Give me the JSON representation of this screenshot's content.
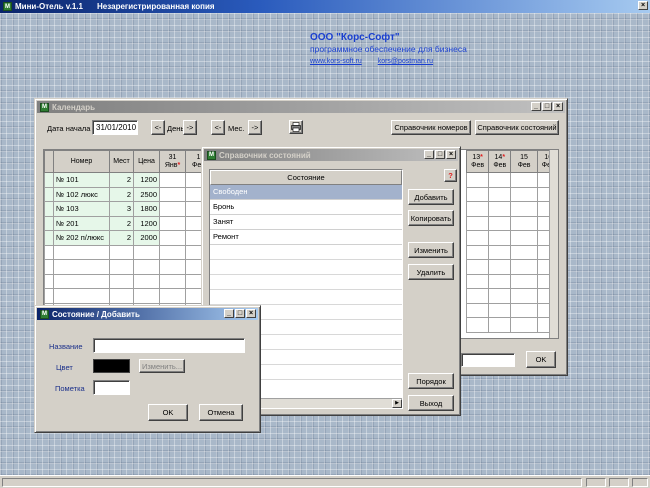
{
  "app": {
    "title": "Мини-Отель v.1.1",
    "subtitle": "Незарегистрированная копия"
  },
  "company": {
    "name": "ООО \"Корс-Софт\"",
    "tagline": "программное обеспечение для бизнеса",
    "site": "www.kors-soft.ru",
    "email": "kors@postman.ru"
  },
  "calendar": {
    "title": "Календарь",
    "start_label": "Дата начала",
    "start_value": "31/01/2010",
    "day_prev": "<-",
    "day_label": "День",
    "day_next": "->",
    "month_prev": "<-",
    "month_label": "Мес.",
    "month_next": "->",
    "rooms_button": "Справочник номеров",
    "states_button": "Справочник состояний",
    "columns": {
      "number": "Номер",
      "seats": "Мест",
      "price": "Цена"
    },
    "days_left": [
      {
        "d": "31",
        "m": "Янв"
      },
      {
        "d": "1",
        "m": "Фев"
      }
    ],
    "days_right": [
      {
        "d": "13",
        "m": "Фев"
      },
      {
        "d": "14",
        "m": "Фев"
      },
      {
        "d": "15",
        "m": "Фев"
      },
      {
        "d": "16",
        "m": "Фев"
      }
    ],
    "rows": [
      {
        "number": "№ 101",
        "seats": "2",
        "price": "1200"
      },
      {
        "number": "№ 102 люкс",
        "seats": "2",
        "price": "2500"
      },
      {
        "number": "№ 103",
        "seats": "3",
        "price": "1800"
      },
      {
        "number": "№ 201",
        "seats": "2",
        "price": "1200"
      },
      {
        "number": "№ 202 п/люкс",
        "seats": "2",
        "price": "2000"
      }
    ],
    "ok": "OK"
  },
  "states_dir": {
    "title": "Справочник состояний",
    "column": "Состояние",
    "items": [
      "Свободен",
      "Бронь",
      "Занят",
      "Ремонт"
    ],
    "help": "?",
    "add": "Добавить",
    "copy": "Копировать",
    "edit": "Изменить",
    "delete": "Удалить",
    "order": "Порядок",
    "exit": "Выход"
  },
  "state_add": {
    "title": "Состояние / Добавить",
    "name_label": "Название",
    "name_value": "",
    "color_label": "Цвет",
    "color_value": "#000000",
    "change_button": "Изменить...",
    "note_label": "Пометка",
    "note_value": "",
    "ok": "OK",
    "cancel": "Отмена"
  }
}
